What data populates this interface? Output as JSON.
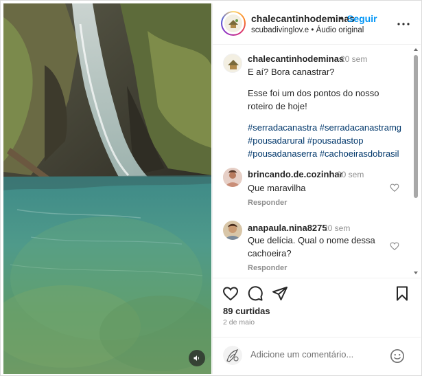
{
  "post": {
    "username": "chalecantinhodeminas",
    "separator": "•",
    "follow_label": "Seguir",
    "subtitle": "scubadivinglov.e • Áudio original",
    "caption": {
      "username": "chalecantinhodeminas",
      "time": "20 sem",
      "line1": "E aí? Bora canastrar?",
      "line2": "Esse foi um dos pontos do nosso",
      "line3": "roteiro de hoje!",
      "hashtags": [
        [
          "#serradacanastra",
          "#serradacanastramg"
        ],
        [
          "#pousadarural",
          "#pousadastop"
        ],
        [
          "#pousadanaserra",
          "#cachoeirasdobrasil"
        ]
      ]
    },
    "comments": [
      {
        "username": "brincando.de.cozinhar",
        "time": "20 sem",
        "lines": [
          "Que maravilha"
        ],
        "reply_label": "Responder"
      },
      {
        "username": "anapaula.nina8275",
        "time": "20 sem",
        "lines": [
          "Que delícia. Qual o nome dessa",
          "cachoeira?"
        ],
        "reply_label": "Responder"
      }
    ],
    "likes": "89 curtidas",
    "date": "2 de maio",
    "add_comment_placeholder": "Adicione um comentário..."
  },
  "icons": {
    "more": "more-horizontal-icon",
    "heart": "heart-icon",
    "comment": "comment-icon",
    "share": "send-icon",
    "save": "bookmark-icon",
    "emoji": "emoji-icon",
    "sound": "speaker-icon"
  },
  "colors": {
    "link_blue": "#0095f6",
    "hashtag": "#00376b",
    "muted": "#8e8e8e",
    "text": "#262626"
  }
}
